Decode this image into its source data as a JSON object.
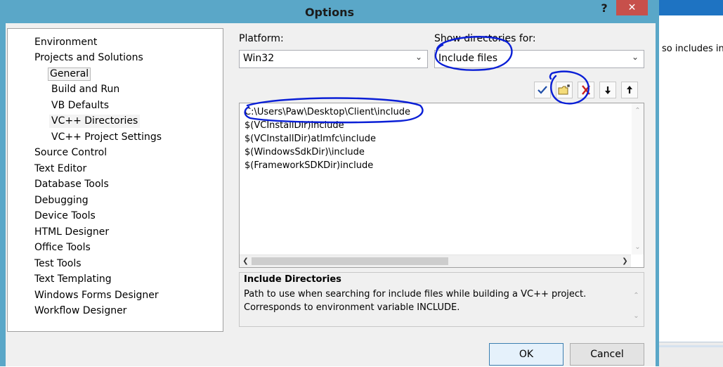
{
  "background_window": {
    "partial_text": "so includes in"
  },
  "dialog": {
    "title": "Options",
    "help_label": "?",
    "close_label": "✕"
  },
  "tree": {
    "items": [
      {
        "label": "Environment"
      },
      {
        "label": "Projects and Solutions"
      },
      {
        "label": "General"
      },
      {
        "label": "Build and Run"
      },
      {
        "label": "VB Defaults"
      },
      {
        "label": "VC++ Directories"
      },
      {
        "label": "VC++ Project Settings"
      },
      {
        "label": "Source Control"
      },
      {
        "label": "Text Editor"
      },
      {
        "label": "Database Tools"
      },
      {
        "label": "Debugging"
      },
      {
        "label": "Device Tools"
      },
      {
        "label": "HTML Designer"
      },
      {
        "label": "Office Tools"
      },
      {
        "label": "Test Tools"
      },
      {
        "label": "Text Templating"
      },
      {
        "label": "Windows Forms Designer"
      },
      {
        "label": "Workflow Designer"
      }
    ]
  },
  "platform": {
    "label": "Platform:",
    "value": "Win32"
  },
  "show_dirs": {
    "label": "Show directories for:",
    "value": "Include files"
  },
  "directories": [
    "C:\\Users\\Paw\\Desktop\\Client\\include",
    "$(VCInstallDir)include",
    "$(VCInstallDir)atlmfc\\include",
    "$(WindowsSdkDir)\\include",
    "$(FrameworkSDKDir)include"
  ],
  "description": {
    "title": "Include Directories",
    "line1": "Path to use when searching for include files while building a VC++ project.",
    "line2": "Corresponds to environment variable INCLUDE."
  },
  "buttons": {
    "ok": "OK",
    "cancel": "Cancel"
  },
  "colors": {
    "title_bar": "#5aa7c8",
    "close_button": "#c7504b",
    "annotation_ink": "#0a1fd6"
  }
}
